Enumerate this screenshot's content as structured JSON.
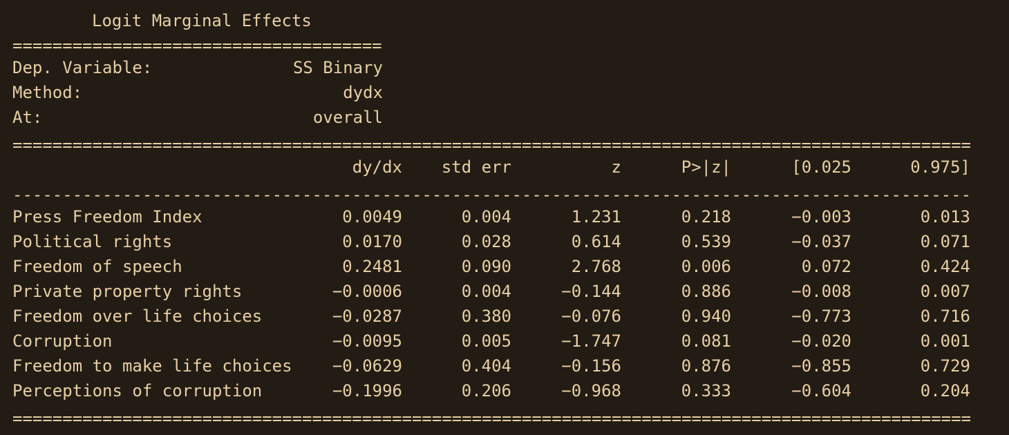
{
  "title": "Logit Marginal Effects",
  "short_rule": "=====================================",
  "long_rule": "================================================================================================",
  "dash_rule": "------------------------------------------------------------------------------------------------",
  "info": [
    {
      "label": "Dep. Variable:",
      "value": "SS Binary"
    },
    {
      "label": "Method:",
      "value": "dydx"
    },
    {
      "label": "At:",
      "value": "overall"
    }
  ],
  "columns": [
    "dy/dx",
    "std err",
    "z",
    "P>|z|",
    "[0.025",
    "0.975]"
  ],
  "rows": [
    {
      "name": "Press Freedom Index",
      "values": [
        "0.0049",
        "0.004",
        "1.231",
        "0.218",
        "-0.003",
        "0.013"
      ]
    },
    {
      "name": "Political rights",
      "values": [
        "0.0170",
        "0.028",
        "0.614",
        "0.539",
        "-0.037",
        "0.071"
      ]
    },
    {
      "name": "Freedom of speech",
      "values": [
        "0.2481",
        "0.090",
        "2.768",
        "0.006",
        "0.072",
        "0.424"
      ]
    },
    {
      "name": "Private property rights",
      "values": [
        "-0.0006",
        "0.004",
        "-0.144",
        "0.886",
        "-0.008",
        "0.007"
      ]
    },
    {
      "name": "Freedom over life choices",
      "values": [
        "-0.0287",
        "0.380",
        "-0.076",
        "0.940",
        "-0.773",
        "0.716"
      ]
    },
    {
      "name": "Corruption",
      "values": [
        "-0.0095",
        "0.005",
        "-1.747",
        "0.081",
        "-0.020",
        "0.001"
      ]
    },
    {
      "name": "Freedom to make life choices",
      "values": [
        "-0.0629",
        "0.404",
        "-0.156",
        "0.876",
        "-0.855",
        "0.729"
      ]
    },
    {
      "name": "Perceptions of corruption",
      "values": [
        "-0.1996",
        "0.206",
        "-0.968",
        "0.333",
        "-0.604",
        "0.204"
      ]
    }
  ]
}
